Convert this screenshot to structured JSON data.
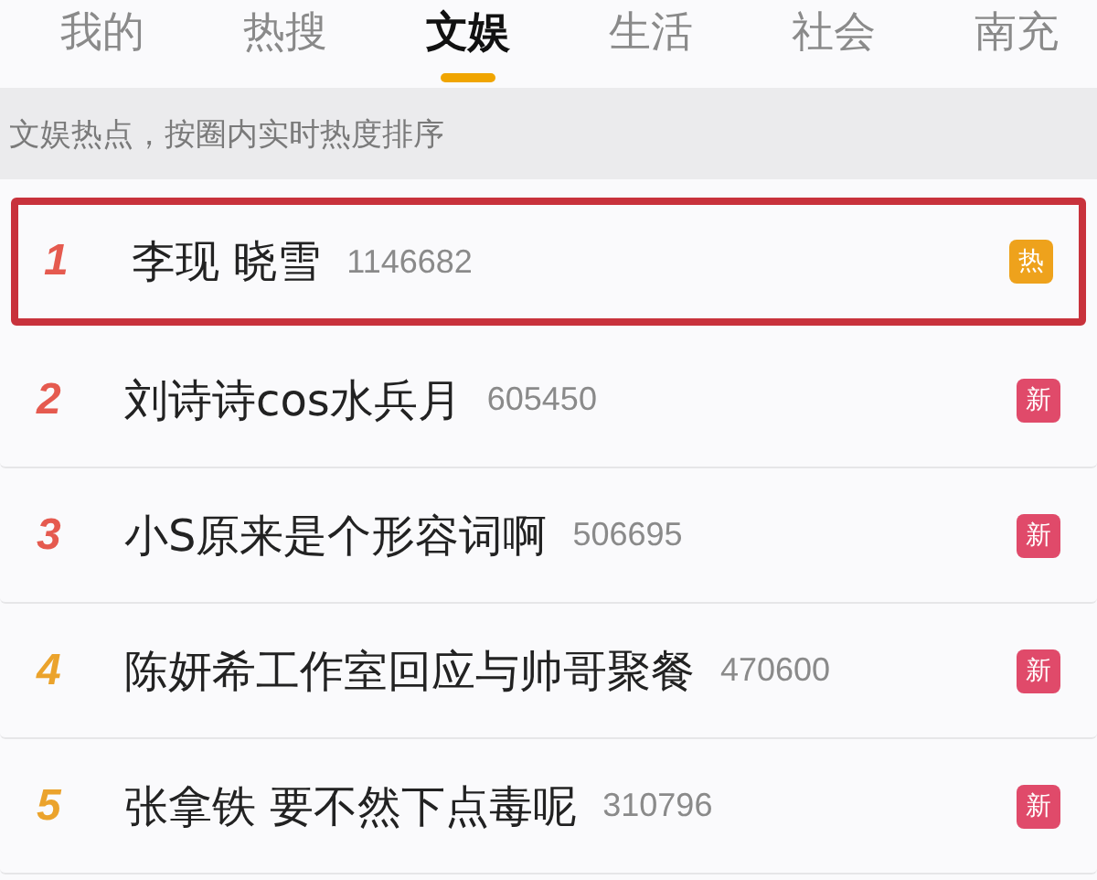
{
  "tabs": [
    {
      "label": "我的",
      "selected": false
    },
    {
      "label": "热搜",
      "selected": false
    },
    {
      "label": "文娱",
      "selected": true
    },
    {
      "label": "生活",
      "selected": false
    },
    {
      "label": "社会",
      "selected": false
    },
    {
      "label": "南充",
      "selected": false
    }
  ],
  "notice": "文娱热点，按圈内实时热度排序",
  "items": [
    {
      "rank": "1",
      "color": "#e55a4f",
      "title": "李现 晓雪",
      "count": "1146682",
      "badge": "热",
      "kind": "hot",
      "highlighted": true
    },
    {
      "rank": "2",
      "color": "#e55a4f",
      "title": "刘诗诗cos水兵月",
      "count": "605450",
      "badge": "新",
      "kind": "new",
      "highlighted": false
    },
    {
      "rank": "3",
      "color": "#e55a4f",
      "title": "小S原来是个形容词啊",
      "count": "506695",
      "badge": "新",
      "kind": "new",
      "highlighted": false
    },
    {
      "rank": "4",
      "color": "#eba32c",
      "title": "陈妍希工作室回应与帅哥聚餐",
      "count": "470600",
      "badge": "新",
      "kind": "new",
      "highlighted": false
    },
    {
      "rank": "5",
      "color": "#eba32c",
      "title": "张拿铁 要不然下点毒呢",
      "count": "310796",
      "badge": "新",
      "kind": "new",
      "highlighted": false
    }
  ]
}
